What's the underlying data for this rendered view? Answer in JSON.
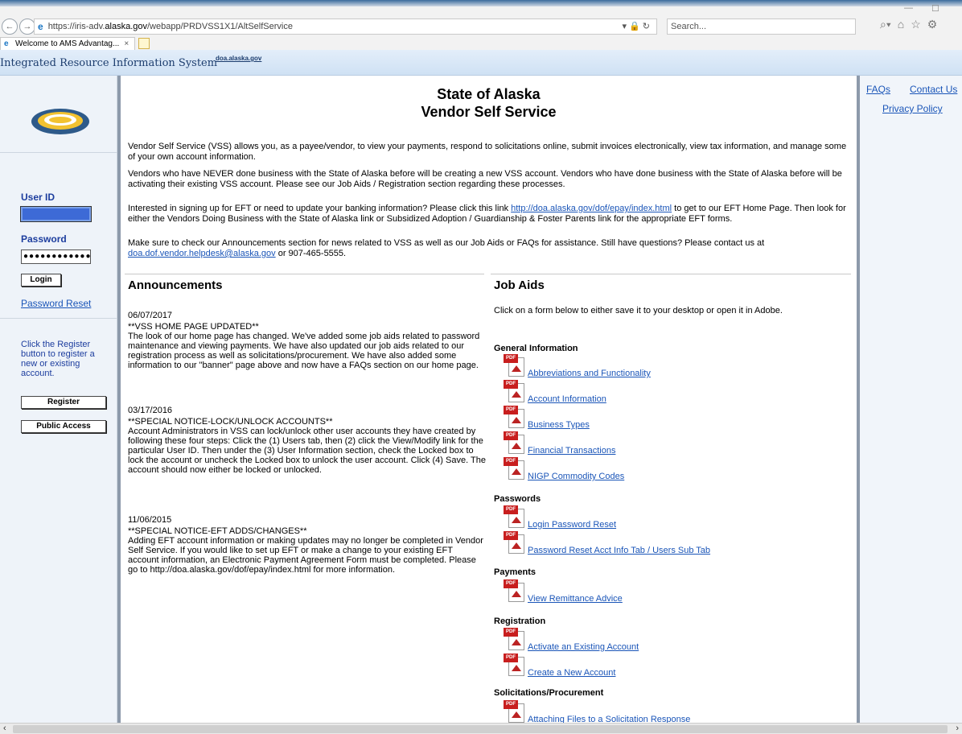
{
  "browser": {
    "url_prefix": "https://iris-adv.",
    "url_domain": "alaska.gov",
    "url_path": "/webapp/PRDVSS1X1/AltSelfService",
    "search_placeholder": "Search...",
    "tab_title": "Welcome to AMS Advantag...",
    "tab_close": "×"
  },
  "header": {
    "system_title": "Integrated Resource Information System",
    "site_link": "doa.alaska.gov"
  },
  "login": {
    "user_id_label": "User ID",
    "password_label": "Password",
    "password_mask": "●●●●●●●●●●●●",
    "login_button": "Login",
    "password_reset": "Password Reset",
    "register_text": "Click the Register button to register a new or existing account.",
    "register_button": "Register",
    "public_access_button": "Public Access"
  },
  "main": {
    "title_line1": "State of Alaska",
    "title_line2": "Vendor Self Service",
    "p1": "Vendor Self Service (VSS) allows you, as a payee/vendor, to view your payments, respond to solicitations online, submit invoices electronically, view tax information, and manage some of your own account information.",
    "p2": "Vendors who have NEVER done business with the State of Alaska before will be creating a new VSS account. Vendors who have done business with the State of Alaska before will be activating their existing VSS account. Please see our Job Aids / Registration section regarding these processes.",
    "p3_a": "Interested in signing up for EFT or need to update your banking information? Please click this link ",
    "p3_link": "http://doa.alaska.gov/dof/epay/index.html",
    "p3_b": " to get to our EFT Home Page. Then look for either the Vendors Doing Business with the State of Alaska link or Subsidized Adoption / Guardianship & Foster Parents link for the appropriate EFT forms.",
    "p4_a": "Make sure to check our Announcements section for news related to VSS as well as our Job Aids or FAQs for assistance. Still have questions? Please contact us at ",
    "p4_link": "doa.dof.vendor.helpdesk@alaska.gov",
    "p4_b": " or 907-465-5555."
  },
  "announcements": {
    "heading": "Announcements",
    "items": [
      {
        "date": "06/07/2017",
        "title": "**VSS HOME PAGE UPDATED**",
        "body": "The look of our home page has changed. We've added some job aids related to password maintenance and viewing payments. We have also updated our job aids related to our registration process as well as solicitations/procurement. We have also added some information to our \"banner\" page above and now have a FAQs section on our home page."
      },
      {
        "date": "03/17/2016",
        "title": "**SPECIAL NOTICE-LOCK/UNLOCK ACCOUNTS**",
        "body": "Account Administrators in VSS can lock/unlock other user accounts they have created by following these four steps: Click the (1) Users tab, then (2) click the View/Modify link for the particular User ID. Then under the (3) User Information section, check the Locked box to lock the account or uncheck the Locked box to unlock the user account. Click (4) Save. The account should now either be locked or unlocked."
      },
      {
        "date": "11/06/2015",
        "title": "**SPECIAL NOTICE-EFT ADDS/CHANGES**",
        "body": "Adding EFT account information or making updates may no longer be completed in Vendor Self Service. If you would like to set up EFT or make a change to your existing EFT account information, an Electronic Payment Agreement Form must be completed. Please go to http://doa.alaska.gov/dof/epay/index.html for more information."
      }
    ]
  },
  "job_aids": {
    "heading": "Job Aids",
    "intro": "Click on a form below to either save it to your desktop or open it in Adobe.",
    "pdf_tag": "PDF",
    "categories": {
      "general": "General Information",
      "passwords": "Passwords",
      "payments": "Payments",
      "registration": "Registration",
      "solicitations": "Solicitations/Procurement"
    },
    "links": {
      "abbrev": "Abbreviations and Functionality",
      "account_info": "Account Information",
      "business_types": "Business Types",
      "financial": "Financial Transactions",
      "nigp": "NIGP Commodity Codes",
      "login_reset": "Login Password Reset",
      "pw_reset_acct": "Password Reset Acct Info Tab / Users Sub Tab",
      "remittance": "View Remittance Advice",
      "activate": "Activate an Existing Account",
      "create": "Create a New Account",
      "attaching": "Attaching Files to a Solicitation Response"
    }
  },
  "right_nav": {
    "faqs": "FAQs",
    "contact": "Contact Us",
    "privacy": "Privacy Policy"
  }
}
